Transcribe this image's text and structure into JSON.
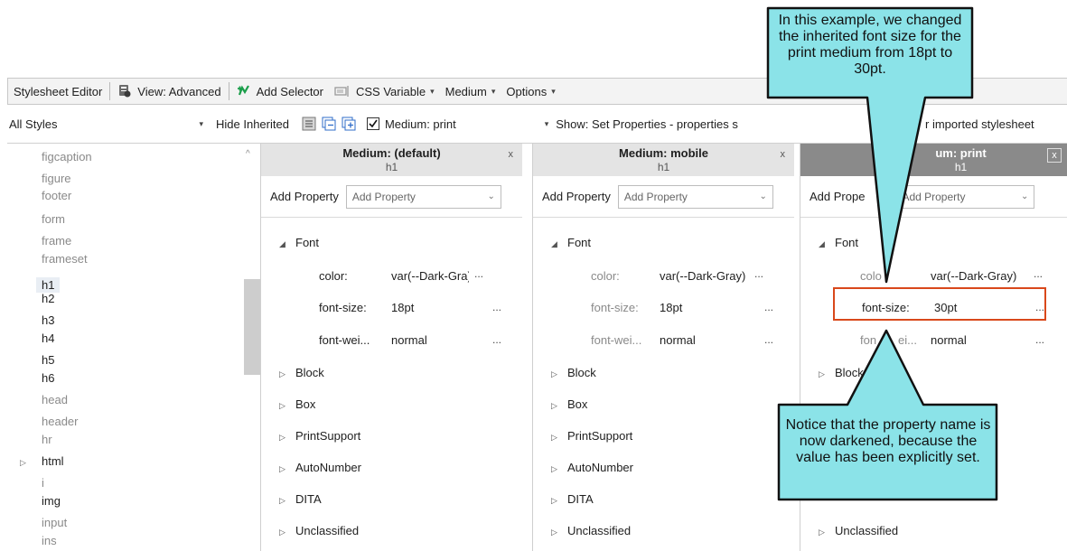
{
  "toolbar": {
    "title": "Stylesheet Editor",
    "view": "View: Advanced",
    "add_selector": "Add Selector",
    "css_variable": "CSS Variable",
    "medium": "Medium",
    "options": "Options"
  },
  "filterbar": {
    "styles_combo": "All Styles",
    "hide_inherited": "Hide Inherited",
    "medium_checkbox": "Medium: print",
    "show_combo": "Show: Set Properties - properties s",
    "show_combo_tail": "r imported stylesheet"
  },
  "selectors": [
    "figcaption",
    "figure",
    "footer",
    "form",
    "frame",
    "frameset",
    "h1",
    "h2",
    "h3",
    "h4",
    "h5",
    "h6",
    "head",
    "header",
    "hr",
    "html",
    "i",
    "img",
    "input",
    "ins"
  ],
  "panels": [
    {
      "title": "Medium: (default)",
      "selector": "h1",
      "close": "x",
      "add_property_label": "Add Property",
      "add_property_placeholder": "Add Property",
      "font_group": "Font",
      "props": [
        {
          "name": "color:",
          "value": "var(--Dark-Gra)",
          "more": "..."
        },
        {
          "name": "font-size:",
          "value": "18pt",
          "more": "..."
        },
        {
          "name": "font-wei...",
          "value": "normal",
          "more": "..."
        }
      ],
      "groups": [
        "Block",
        "Box",
        "PrintSupport",
        "AutoNumber",
        "DITA",
        "Unclassified"
      ]
    },
    {
      "title": "Medium: mobile",
      "selector": "h1",
      "close": "x",
      "add_property_label": "Add Property",
      "add_property_placeholder": "Add Property",
      "font_group": "Font",
      "props": [
        {
          "name": "color:",
          "value": "var(--Dark-Gray)",
          "more": "..."
        },
        {
          "name": "font-size:",
          "value": "18pt",
          "more": "..."
        },
        {
          "name": "font-wei...",
          "value": "normal",
          "more": "..."
        }
      ],
      "groups": [
        "Block",
        "Box",
        "PrintSupport",
        "AutoNumber",
        "DITA",
        "Unclassified"
      ]
    },
    {
      "title": "um: print",
      "selector": "h1",
      "close": "x",
      "add_property_label": "Add Prope",
      "add_property_placeholder": "Add Property",
      "font_group": "Font",
      "props": [
        {
          "name": "colo",
          "value": "var(--Dark-Gray)",
          "more": "..."
        },
        {
          "name": "font-size:",
          "value": "30pt",
          "more": "..."
        },
        {
          "name": "fon",
          "name_tail": "ei...",
          "value": "normal",
          "more": "..."
        }
      ],
      "groups": [
        "Block",
        "Unclassified"
      ]
    }
  ],
  "callouts": {
    "top": "In this example, we changed the inherited font size for the print medium from 18pt to 30pt.",
    "bottom": "Notice that the property name is now darkened, because the value has been explicitly set."
  },
  "colors": {
    "callout_fill": "#8be3e8",
    "highlight": "#d9481b",
    "print_header": "#8a8a8a"
  }
}
